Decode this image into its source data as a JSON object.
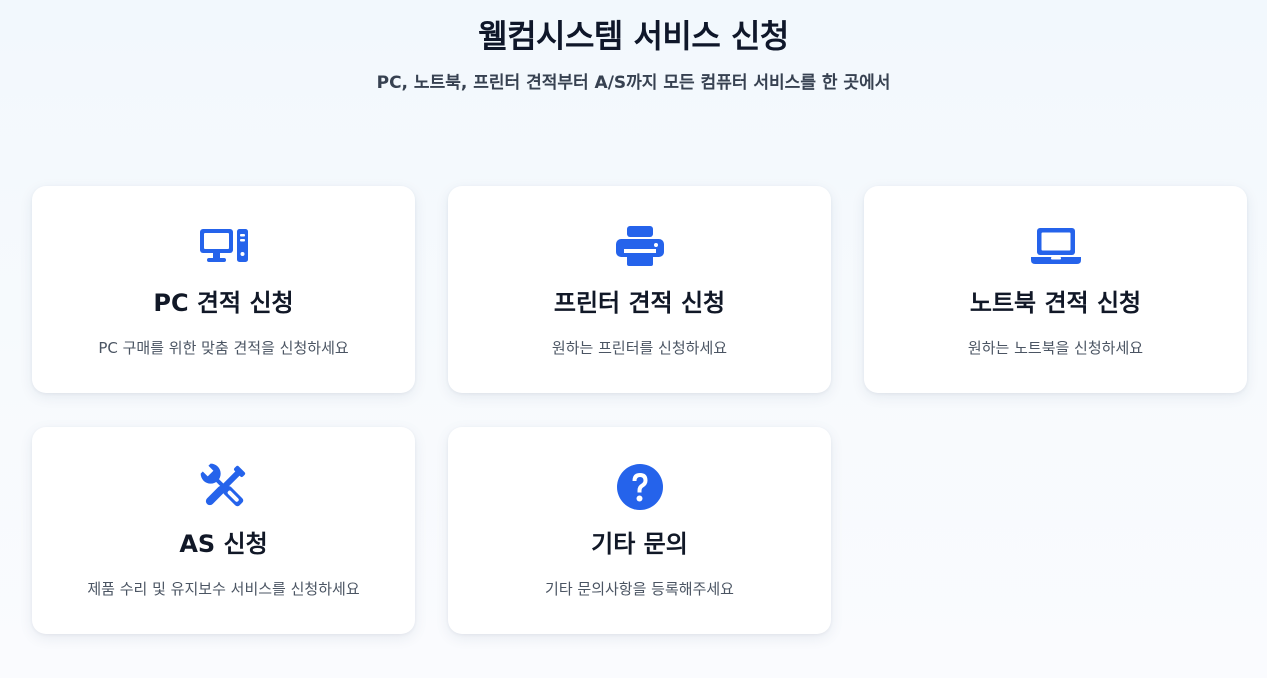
{
  "header": {
    "title": "웰컴시스템 서비스 신청",
    "subtitle": "PC, 노트북, 프린터 견적부터 A/S까지 모든 컴퓨터 서비스를 한 곳에서"
  },
  "accent_color": "#2563eb",
  "cards": [
    {
      "icon": "desktop-computer-icon",
      "title": "PC 견적 신청",
      "description": "PC 구매를 위한 맞춤 견적을 신청하세요"
    },
    {
      "icon": "printer-icon",
      "title": "프린터 견적 신청",
      "description": "원하는 프린터를 신청하세요"
    },
    {
      "icon": "laptop-icon",
      "title": "노트북 견적 신청",
      "description": "원하는 노트북을 신청하세요"
    },
    {
      "icon": "tools-icon",
      "title": "AS 신청",
      "description": "제품 수리 및 유지보수 서비스를 신청하세요"
    },
    {
      "icon": "question-circle-icon",
      "title": "기타 문의",
      "description": "기타 문의사항을 등록해주세요"
    }
  ]
}
